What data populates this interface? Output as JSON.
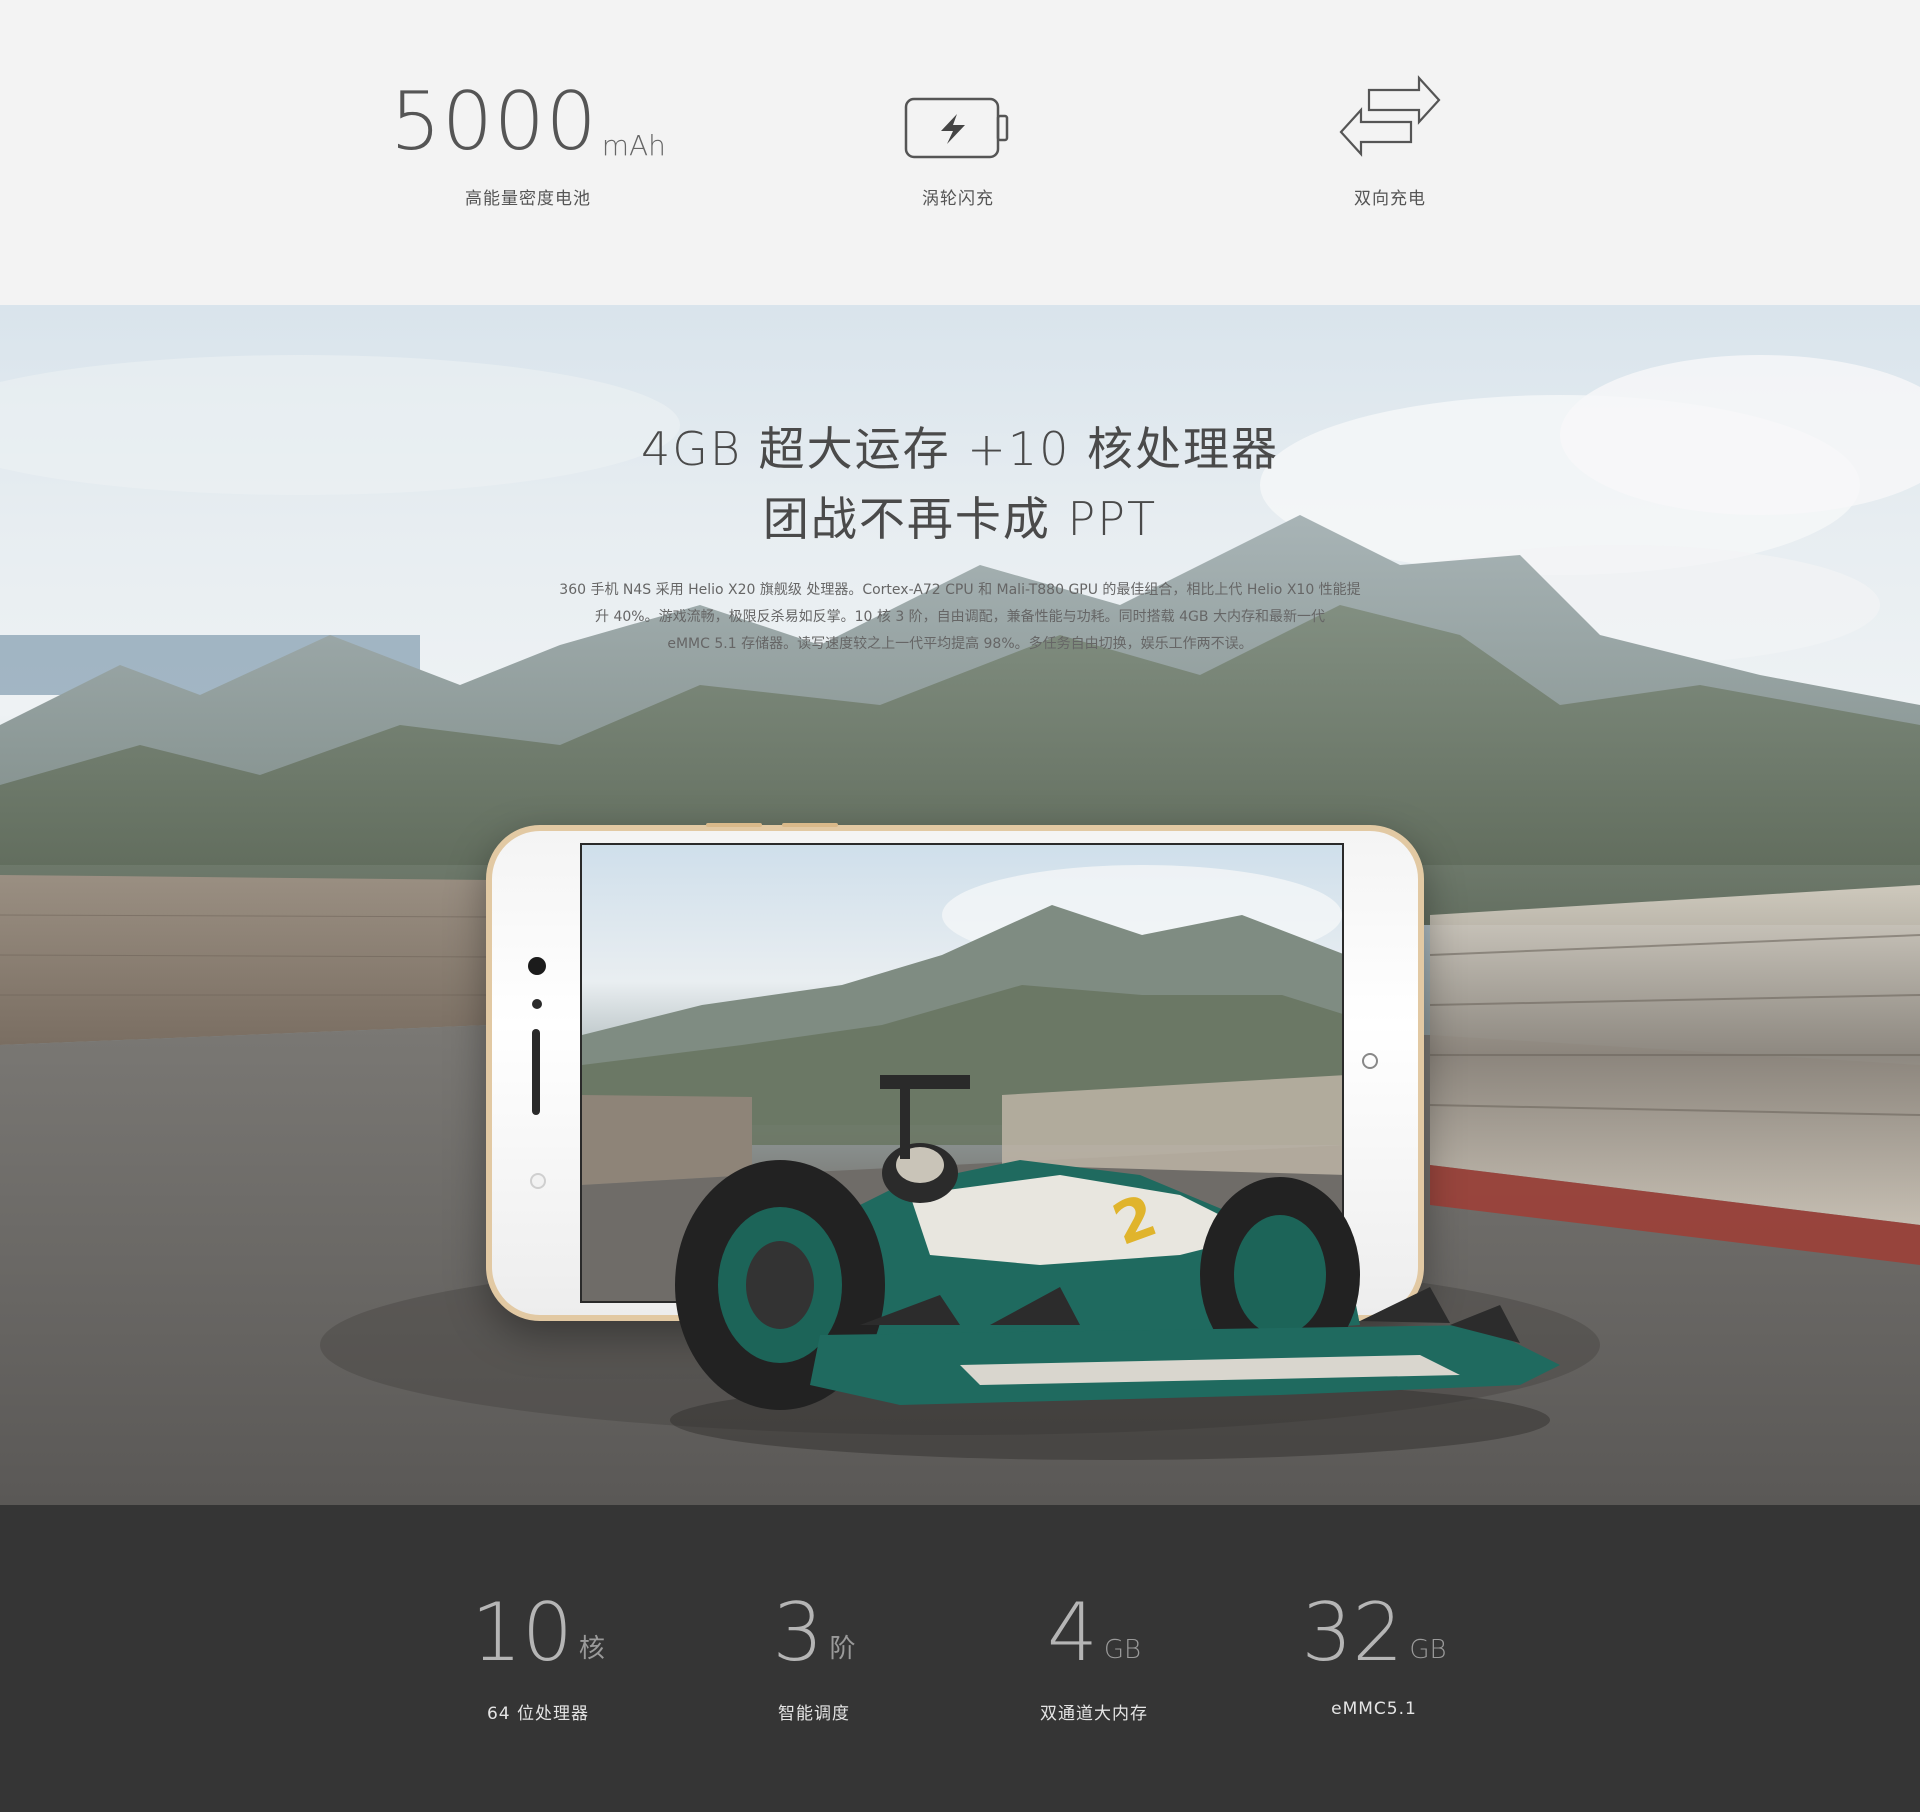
{
  "battery_strip": {
    "capacity": {
      "value": "5000",
      "unit": "mAh",
      "caption": "高能量密度电池"
    },
    "fast_charge": {
      "icon": "battery-bolt-icon",
      "caption": "涡轮闪充"
    },
    "reverse_charge": {
      "icon": "bidirectional-arrows-icon",
      "caption": "双向充电"
    }
  },
  "hero": {
    "title_line1": "4GB 超大运存 +10 核处理器",
    "title_line2": "团战不再卡成 PPT",
    "desc_line1": "360 手机 N4S 采用 Helio  X20 旗舰级 处理器。Cortex-A72 CPU 和 Mali-T880 GPU 的最佳组合，相比上代 Helio X10 性能提",
    "desc_line2": "升 40%。游戏流畅，极限反杀易如反掌。10 核 3 阶，自由调配，兼备性能与功耗。同时搭载 4GB 大内存和最新一代",
    "desc_line3": "eMMC 5.1  存储器。读写速度较之上一代平均提高 98%。多任务自由切换，娱乐工作两不误。",
    "race_car_number": "2"
  },
  "specs": [
    {
      "value": "10",
      "unit": "核",
      "label": "64 位处理器"
    },
    {
      "value": "3",
      "unit": "阶",
      "label": "智能调度"
    },
    {
      "value": "4",
      "unit": "GB",
      "label": "双通道大内存"
    },
    {
      "value": "32",
      "unit": "GB",
      "label": "eMMC5.1"
    }
  ]
}
